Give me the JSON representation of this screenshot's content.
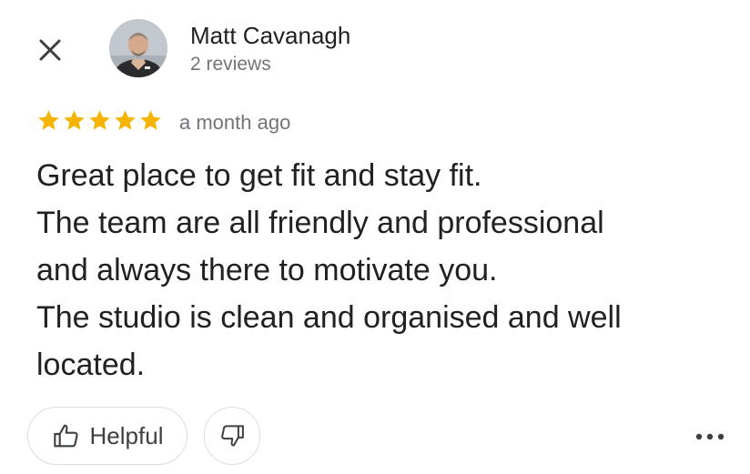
{
  "reviewer": {
    "name": "Matt Cavanagh",
    "reviews_count": "2 reviews"
  },
  "review": {
    "rating": 5,
    "date": "a month ago",
    "lines": [
      "Great place to get fit and stay fit.",
      "The team are all friendly and professional",
      "and always there to motivate you.",
      "The studio is clean and organised and well",
      "located."
    ]
  },
  "actions": {
    "helpful_label": "Helpful"
  },
  "icons": {
    "close": "close-icon",
    "star": "star-icon",
    "thumbs_up": "thumbs-up-icon",
    "thumbs_down": "thumbs-down-icon",
    "more": "more-horizontal-icon"
  },
  "colors": {
    "star": "#f4b400",
    "text_primary": "#202124",
    "text_secondary": "#70757a",
    "button_border": "#dadce0"
  }
}
